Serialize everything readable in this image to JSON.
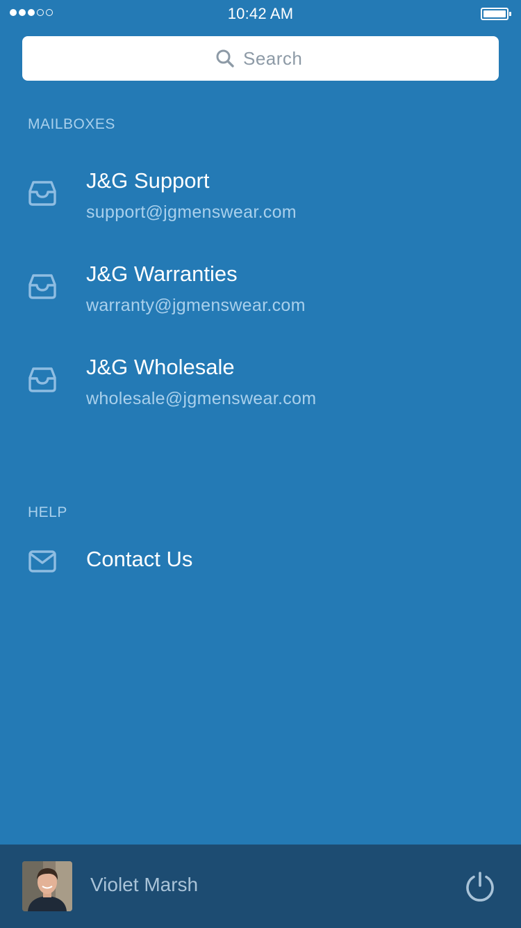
{
  "status_bar": {
    "time": "10:42 AM",
    "signal": [
      true,
      true,
      true,
      false,
      false
    ],
    "battery_level": 1.0
  },
  "search": {
    "placeholder": "Search",
    "value": "",
    "icon": "search-icon"
  },
  "mailboxes": {
    "header": "MAILBOXES",
    "items": [
      {
        "name": "J&G Support",
        "email": "support@jgmenswear.com",
        "icon": "inbox-tray-icon"
      },
      {
        "name": "J&G Warranties",
        "email": "warranty@jgmenswear.com",
        "icon": "inbox-tray-icon"
      },
      {
        "name": "J&G Wholesale",
        "email": "wholesale@jgmenswear.com",
        "icon": "inbox-tray-icon"
      }
    ]
  },
  "help": {
    "header": "HELP",
    "items": [
      {
        "label": "Contact Us",
        "icon": "envelope-icon"
      }
    ]
  },
  "footer": {
    "user_name": "Violet Marsh",
    "avatar": "avatar",
    "power_icon": "power-icon"
  },
  "colors": {
    "background": "#247AB5",
    "footer_background": "#1D4C72",
    "secondary_text": "#A9D0EC",
    "icon": "#8FBDE2",
    "power_icon": "#A9C3D8"
  }
}
